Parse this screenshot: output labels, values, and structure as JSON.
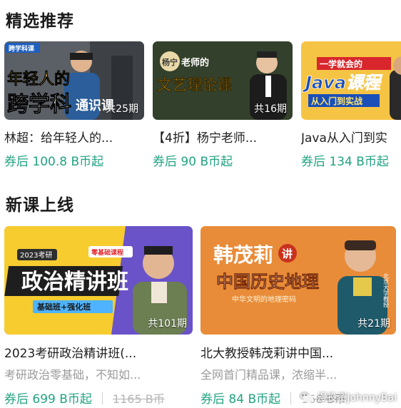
{
  "sections": [
    {
      "title": "精选推荐",
      "cards": [
        {
          "title": "林超：给年轻人的...",
          "price": "券后 100.8 B币起",
          "episodes": "共25期",
          "thumb_text": [
            "年轻人的",
            "跨学科",
            "通识课"
          ],
          "badge": "跨学科课"
        },
        {
          "title": "【4折】杨宁老师...",
          "price": "券后 90 B币起",
          "episodes": "共16期",
          "thumb_text": [
            "杨宁",
            "老师的",
            "文艺理论课"
          ]
        },
        {
          "title": "Java从入门到实",
          "price": "券后 134 B币起",
          "episodes": "",
          "thumb_text": [
            "一学就会的",
            "Java课程",
            "从入门到实战"
          ]
        }
      ]
    },
    {
      "title": "新课上线",
      "cards": [
        {
          "title": "2023考研政治精讲班(...",
          "desc": "考研政治零基础，不知如...",
          "price": "券后 699 B币起",
          "old_price": "1165 B币",
          "episodes": "共101期",
          "thumb_text": [
            "2023考研",
            "零基础课程",
            "政治精讲班",
            "基础班+强化班"
          ]
        },
        {
          "title": "北大教授韩茂莉讲中国...",
          "desc": "全网首门精品课，浓缩半...",
          "price": "券后 84 B币起",
          "old_price": "168 B币",
          "episodes": "共21期",
          "thumb_text": [
            "韩茂莉",
            "讲",
            "中国历史地理",
            "中华文明的地理密码",
            "北京大学教授"
          ]
        }
      ]
    }
  ],
  "watermark": "漫投资JohnnyBai",
  "colors": {
    "price": "#21a383",
    "title": "#1b1b1b",
    "desc": "#9a9a9a"
  }
}
